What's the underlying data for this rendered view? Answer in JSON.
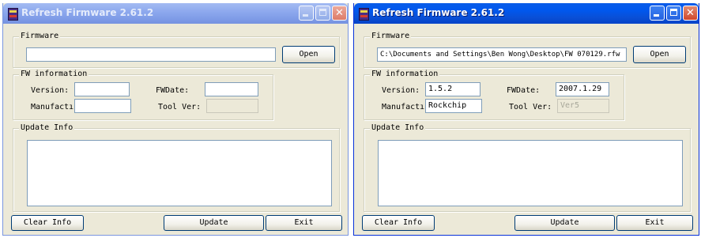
{
  "windows": [
    {
      "title": "Refresh Firmware 2.61.2",
      "state": "inactive",
      "firmware_group_label": "Firmware",
      "firmware_path": "",
      "open_label": "Open",
      "fw_info_group_label": "FW information",
      "version_label": "Version:",
      "version_value": "",
      "fwdate_label": "FWDate:",
      "fwdate_value": "",
      "manufacturer_label": "Manufactı",
      "manufacturer_value": "",
      "toolver_label": "Tool Ver:",
      "toolver_value": "",
      "update_info_group_label": "Update Info",
      "update_info_text": "",
      "clear_info_label": "Clear Info",
      "update_label": "Update",
      "exit_label": "Exit"
    },
    {
      "title": "Refresh Firmware 2.61.2",
      "state": "active",
      "firmware_group_label": "Firmware",
      "firmware_path": "C:\\Documents and Settings\\Ben Wong\\Desktop\\FW 070129.rfw",
      "open_label": "Open",
      "fw_info_group_label": "FW information",
      "version_label": "Version:",
      "version_value": "1.5.2",
      "fwdate_label": "FWDate:",
      "fwdate_value": "2007.1.29",
      "manufacturer_label": "Manufactı",
      "manufacturer_value": "Rockchip",
      "toolver_label": "Tool Ver:",
      "toolver_value": "Ver5",
      "update_info_group_label": "Update Info",
      "update_info_text": "",
      "clear_info_label": "Clear Info",
      "update_label": "Update",
      "exit_label": "Exit"
    }
  ]
}
